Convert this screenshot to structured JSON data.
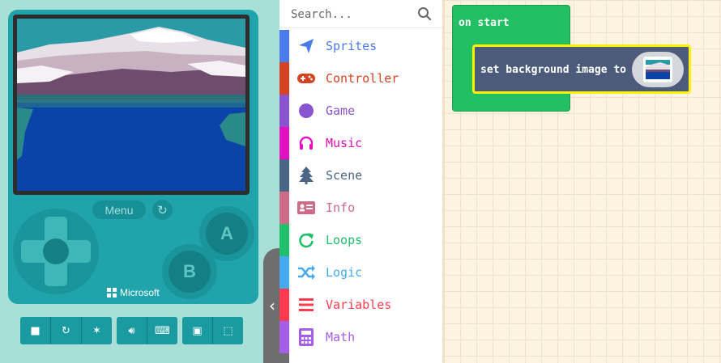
{
  "simulator": {
    "menu_label": "Menu",
    "button_a": "A",
    "button_b": "B",
    "brand": "Microsoft",
    "toolbar_icons": [
      "stop-icon",
      "restart-icon",
      "debug-icon",
      "mute-icon",
      "keyboard-icon",
      "screenshot-icon",
      "fullscreen-icon"
    ]
  },
  "toolbox": {
    "search_placeholder": "Search...",
    "categories": [
      {
        "label": "Sprites",
        "color": "#4b7bec",
        "icon": "paper-plane-icon"
      },
      {
        "label": "Controller",
        "color": "#d54322",
        "icon": "gamepad-icon"
      },
      {
        "label": "Game",
        "color": "#8854d0",
        "icon": "circle-icon"
      },
      {
        "label": "Music",
        "color": "#e30fc0",
        "icon": "headphones-icon"
      },
      {
        "label": "Scene",
        "color": "#4b6584",
        "icon": "tree-icon"
      },
      {
        "label": "Info",
        "color": "#cf6a87",
        "icon": "id-card-icon"
      },
      {
        "label": "Loops",
        "color": "#20bf6b",
        "icon": "refresh-icon"
      },
      {
        "label": "Logic",
        "color": "#45aaf2",
        "icon": "shuffle-icon"
      },
      {
        "label": "Variables",
        "color": "#ff3c4f",
        "icon": "list-icon"
      },
      {
        "label": "Math",
        "color": "#a55eea",
        "icon": "calculator-icon"
      }
    ]
  },
  "workspace": {
    "event_block": "on start",
    "statement_block": "set background image to"
  },
  "colors": {
    "event_green": "#23c063",
    "statement_bg": "#4b5b79",
    "selection": "#fff200"
  }
}
